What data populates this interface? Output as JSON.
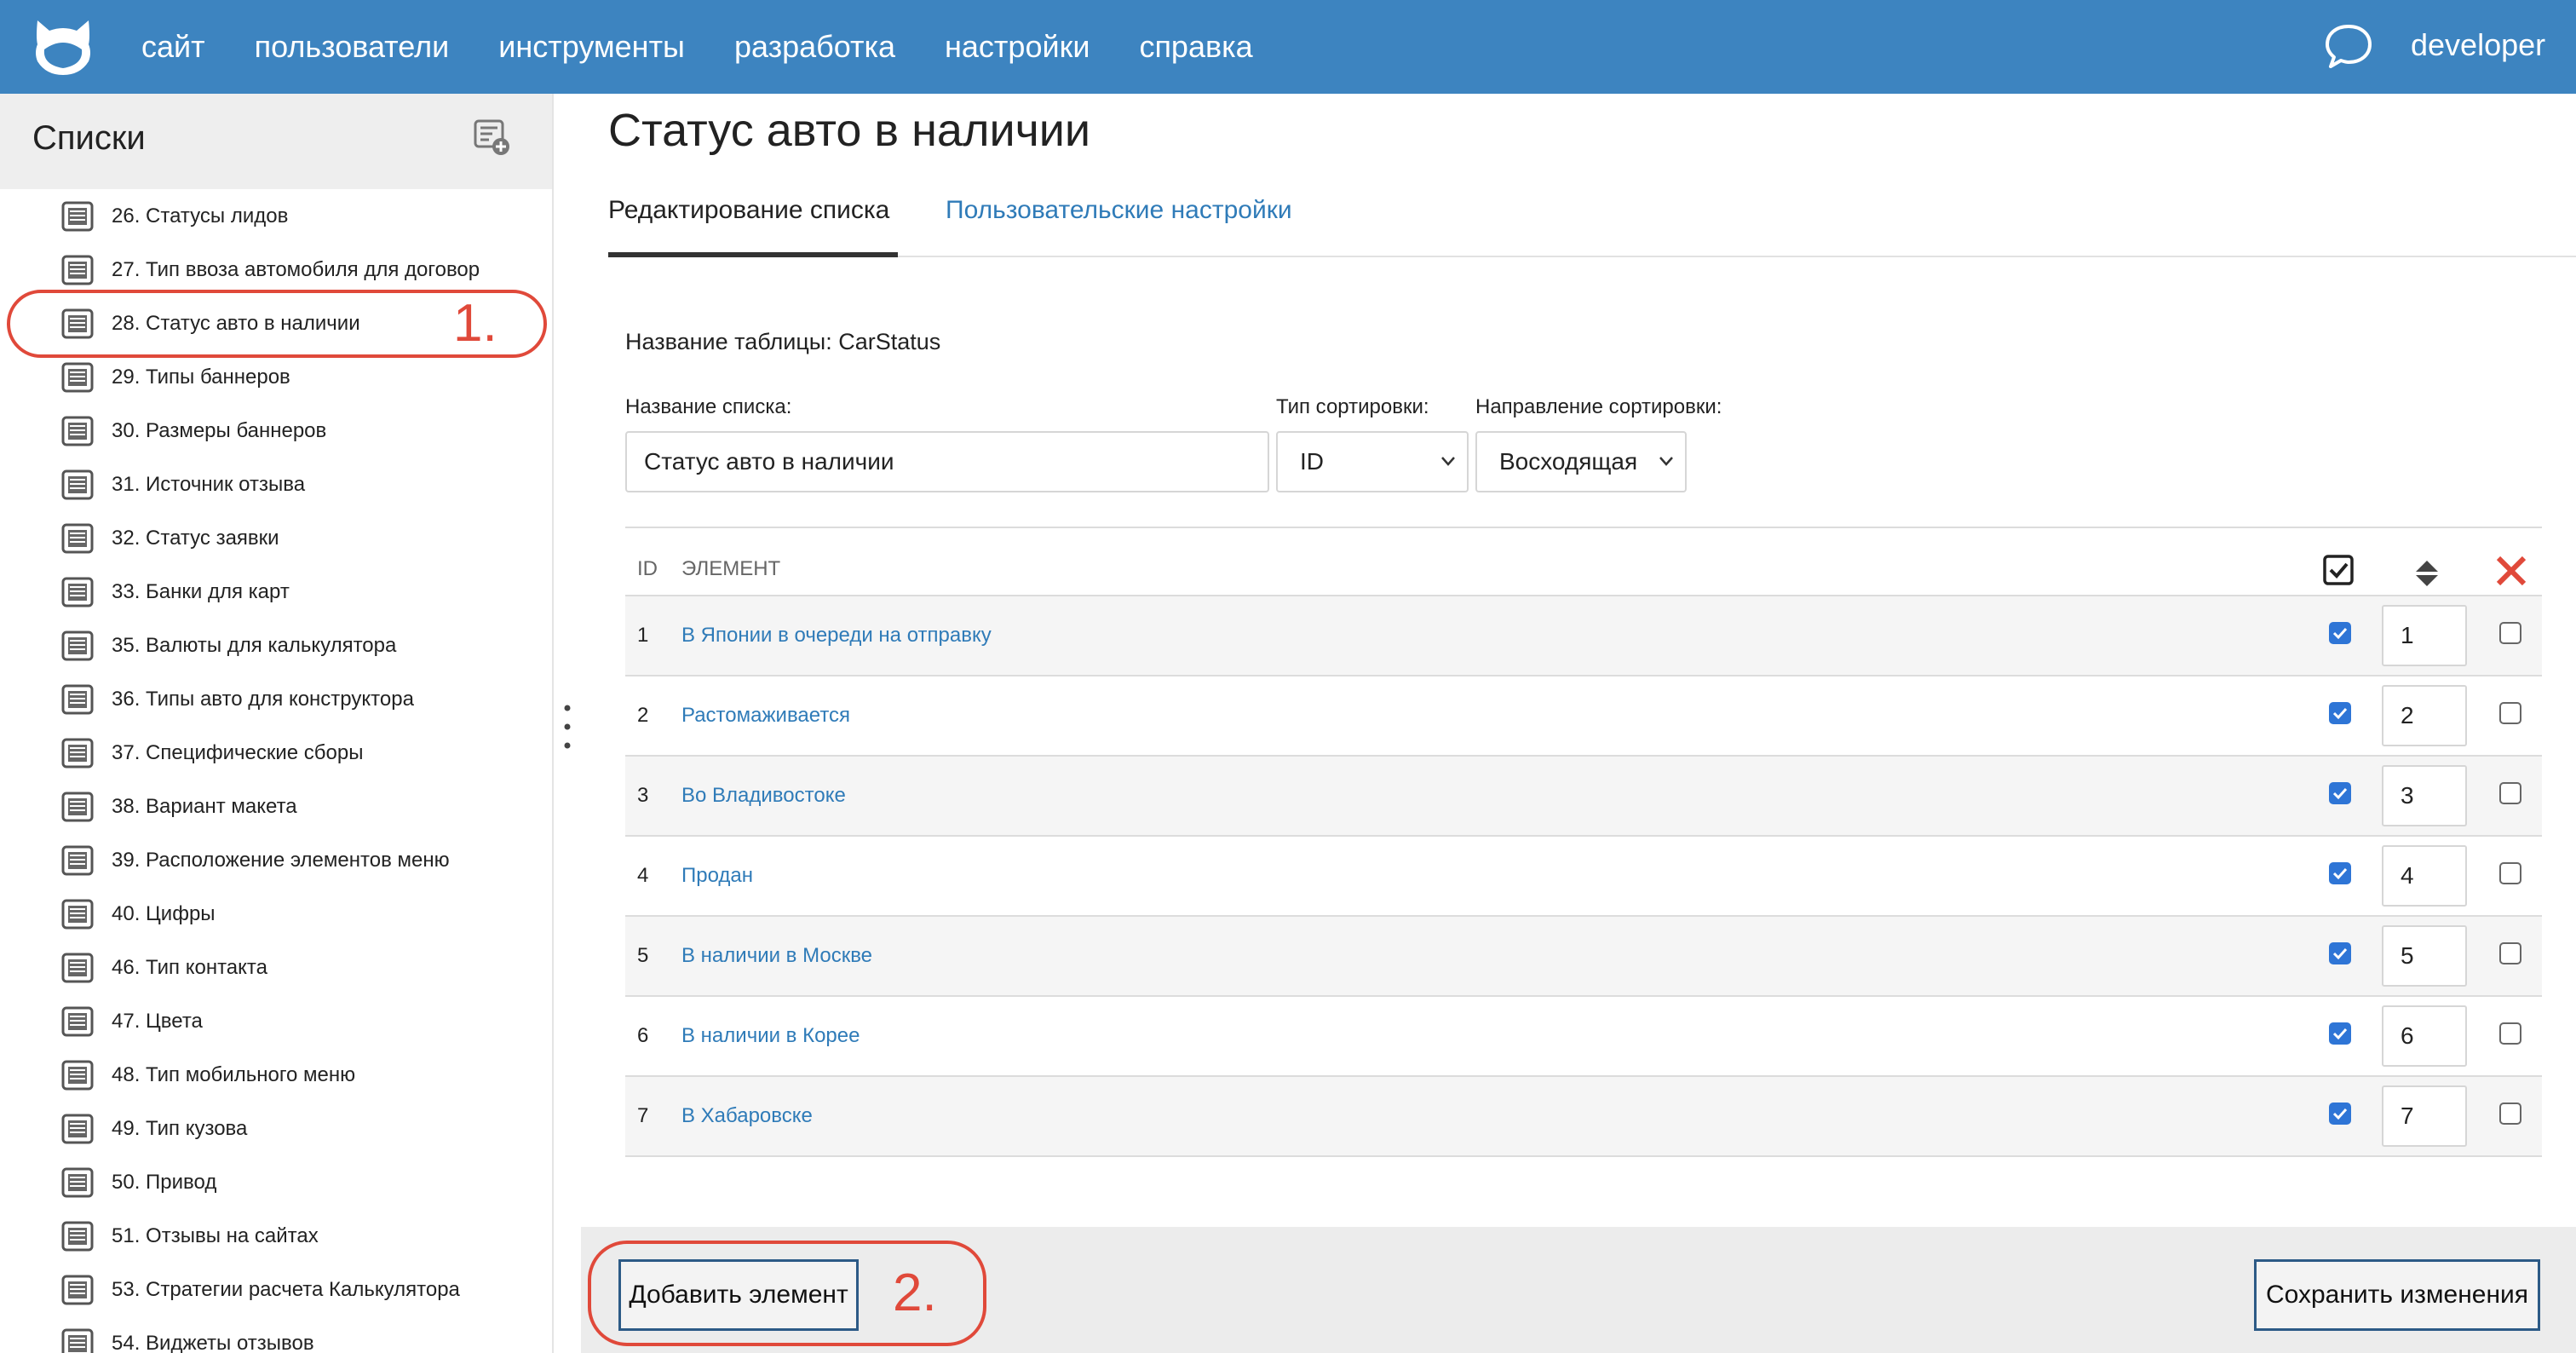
{
  "topbar": {
    "logo": "cat-logo-icon",
    "nav": [
      "сайт",
      "пользователи",
      "инструменты",
      "разработка",
      "настройки",
      "справка"
    ],
    "chat_icon": "chat-bubble-icon",
    "username": "developer",
    "bg_color": "#3d84c0"
  },
  "sidebar": {
    "title": "Списки",
    "add_icon": "add-list-icon",
    "items": [
      {
        "label": "26. Статусы лидов"
      },
      {
        "label": "27. Тип ввоза автомобиля для договор"
      },
      {
        "label": "28. Статус авто в наличии"
      },
      {
        "label": "29. Типы баннеров"
      },
      {
        "label": "30. Размеры баннеров"
      },
      {
        "label": "31. Источник отзыва"
      },
      {
        "label": "32. Статус заявки"
      },
      {
        "label": "33. Банки для карт"
      },
      {
        "label": "35. Валюты для калькулятора"
      },
      {
        "label": "36. Типы авто для конструктора"
      },
      {
        "label": "37. Специфические сборы"
      },
      {
        "label": "38. Вариант макета"
      },
      {
        "label": "39. Расположение элементов меню"
      },
      {
        "label": "40. Цифры"
      },
      {
        "label": "46. Тип контакта"
      },
      {
        "label": "47. Цвета"
      },
      {
        "label": "48. Тип мобильного меню"
      },
      {
        "label": "49. Тип кузова"
      },
      {
        "label": "50. Привод"
      },
      {
        "label": "51. Отзывы на сайтах"
      },
      {
        "label": "53. Стратегии расчета Калькулятора"
      },
      {
        "label": "54. Виджеты отзывов"
      }
    ]
  },
  "main": {
    "title": "Статус авто в наличии",
    "tabs": [
      {
        "label": "Редактирование списка",
        "active": true
      },
      {
        "label": "Пользовательские настройки",
        "active": false
      }
    ],
    "table_name": "Название таблицы: CarStatus",
    "list_name_label": "Название списка:",
    "list_name_value": "Статус авто в наличии",
    "sort_type_label": "Тип сортировки:",
    "sort_type_value": "ID",
    "sort_dir_label": "Направление сортировки:",
    "sort_dir_value": "Восходящая",
    "columns": {
      "id": "ID",
      "element": "ЭЛЕМЕНТ",
      "active_icon": "checkbox-checked-icon",
      "sort_icon": "sort-arrows-icon",
      "delete_icon": "delete-x-icon"
    },
    "rows": [
      {
        "id": "1",
        "name": "В Японии в очереди на отправку",
        "active": true,
        "sort": "1",
        "delete": false
      },
      {
        "id": "2",
        "name": "Растомаживается",
        "active": true,
        "sort": "2",
        "delete": false
      },
      {
        "id": "3",
        "name": "Во Владивостоке",
        "active": true,
        "sort": "3",
        "delete": false
      },
      {
        "id": "4",
        "name": "Продан",
        "active": true,
        "sort": "4",
        "delete": false
      },
      {
        "id": "5",
        "name": "В наличии в Москве",
        "active": true,
        "sort": "5",
        "delete": false
      },
      {
        "id": "6",
        "name": "В наличии в Корее",
        "active": true,
        "sort": "6",
        "delete": false
      },
      {
        "id": "7",
        "name": "В Хабаровске",
        "active": true,
        "sort": "7",
        "delete": false
      }
    ],
    "add_button": "Добавить элемент",
    "save_button": "Сохранить изменения"
  },
  "annotations": {
    "step1": "1.",
    "step2": "2.",
    "color": "#e0493a"
  }
}
